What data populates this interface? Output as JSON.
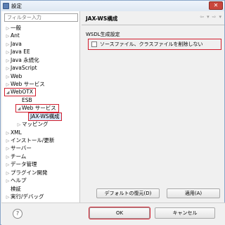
{
  "window": {
    "title": "設定",
    "close_symbol": "✕"
  },
  "filter": {
    "placeholder": "フィルター入力"
  },
  "tree": [
    {
      "label": "一般",
      "arrow": "▷"
    },
    {
      "label": "Ant",
      "arrow": "▷"
    },
    {
      "label": "Java",
      "arrow": "▷"
    },
    {
      "label": "Java EE",
      "arrow": "▷"
    },
    {
      "label": "Java 永続化",
      "arrow": "▷"
    },
    {
      "label": "JavaScript",
      "arrow": "▷"
    },
    {
      "label": "Web",
      "arrow": "▷"
    },
    {
      "label": "Web サービス",
      "arrow": "▷"
    },
    {
      "label": "WebOTX",
      "arrow": "◢"
    },
    {
      "label": "ESB",
      "arrow": ""
    },
    {
      "label": "Web サービス",
      "arrow": "◢"
    },
    {
      "label": "JAX-WS構成",
      "arrow": ""
    },
    {
      "label": "マッピング",
      "arrow": "▷"
    },
    {
      "label": "XML",
      "arrow": "▷"
    },
    {
      "label": "インストール/更新",
      "arrow": "▷"
    },
    {
      "label": "サーバー",
      "arrow": "▷"
    },
    {
      "label": "チーム",
      "arrow": "▷"
    },
    {
      "label": "データ管理",
      "arrow": "▷"
    },
    {
      "label": "プラグイン開発",
      "arrow": "▷"
    },
    {
      "label": "ヘルプ",
      "arrow": "▷"
    },
    {
      "label": "検証",
      "arrow": ""
    },
    {
      "label": "実行/デバッグ",
      "arrow": "▷"
    }
  ],
  "page": {
    "title": "JAX-WS構成",
    "nav": {
      "back": "⇦",
      "back_menu": "▾",
      "forward": "⇨",
      "forward_menu": "▾"
    },
    "group_label": "WSDL生成設定",
    "checkbox_label": "ソースファイル、クラスファイルを削除しない",
    "checkbox_checked": false,
    "restore_defaults": "デフォルトの復元(D)",
    "apply": "適用(A)"
  },
  "bottom": {
    "help": "?",
    "ok": "OK",
    "cancel": "キャンセル"
  },
  "colors": {
    "highlight": "#d21f2e"
  }
}
